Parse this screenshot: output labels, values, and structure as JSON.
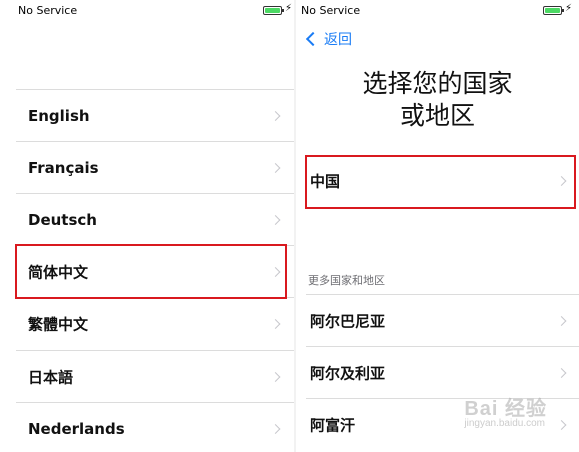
{
  "left": {
    "status_text": "No Service",
    "languages": [
      {
        "label": "English"
      },
      {
        "label": "Français"
      },
      {
        "label": "Deutsch"
      },
      {
        "label": "简体中文"
      },
      {
        "label": "繁體中文"
      },
      {
        "label": "日本語"
      },
      {
        "label": "Nederlands"
      }
    ],
    "highlighted_index": 3
  },
  "right": {
    "status_text": "No Service",
    "back_label": "返回",
    "title_line1": "选择您的国家",
    "title_line2": "或地区",
    "primary_region": {
      "label": "中国"
    },
    "section_header": "更多国家和地区",
    "regions": [
      {
        "label": "阿尔巴尼亚"
      },
      {
        "label": "阿尔及利亚"
      },
      {
        "label": "阿富汗"
      }
    ],
    "watermark": "Bai 经验",
    "watermark_sub": "jingyan.baidu.com"
  },
  "colors": {
    "highlight": "#d9191f",
    "link": "#1a7cf5",
    "battery": "#4cd964"
  },
  "icons": [
    "battery-icon",
    "charging-bolt-icon",
    "chevron-right-icon",
    "back-chevron-icon"
  ]
}
